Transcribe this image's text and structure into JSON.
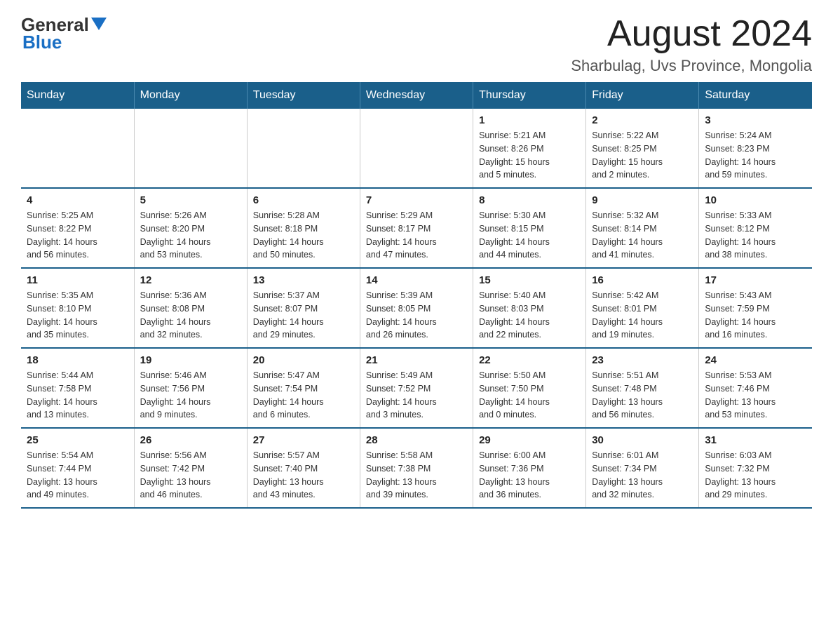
{
  "logo": {
    "general": "General",
    "blue": "Blue"
  },
  "header": {
    "title": "August 2024",
    "location": "Sharbulag, Uvs Province, Mongolia"
  },
  "weekdays": [
    "Sunday",
    "Monday",
    "Tuesday",
    "Wednesday",
    "Thursday",
    "Friday",
    "Saturday"
  ],
  "weeks": [
    [
      {
        "day": "",
        "info": ""
      },
      {
        "day": "",
        "info": ""
      },
      {
        "day": "",
        "info": ""
      },
      {
        "day": "",
        "info": ""
      },
      {
        "day": "1",
        "info": "Sunrise: 5:21 AM\nSunset: 8:26 PM\nDaylight: 15 hours\nand 5 minutes."
      },
      {
        "day": "2",
        "info": "Sunrise: 5:22 AM\nSunset: 8:25 PM\nDaylight: 15 hours\nand 2 minutes."
      },
      {
        "day": "3",
        "info": "Sunrise: 5:24 AM\nSunset: 8:23 PM\nDaylight: 14 hours\nand 59 minutes."
      }
    ],
    [
      {
        "day": "4",
        "info": "Sunrise: 5:25 AM\nSunset: 8:22 PM\nDaylight: 14 hours\nand 56 minutes."
      },
      {
        "day": "5",
        "info": "Sunrise: 5:26 AM\nSunset: 8:20 PM\nDaylight: 14 hours\nand 53 minutes."
      },
      {
        "day": "6",
        "info": "Sunrise: 5:28 AM\nSunset: 8:18 PM\nDaylight: 14 hours\nand 50 minutes."
      },
      {
        "day": "7",
        "info": "Sunrise: 5:29 AM\nSunset: 8:17 PM\nDaylight: 14 hours\nand 47 minutes."
      },
      {
        "day": "8",
        "info": "Sunrise: 5:30 AM\nSunset: 8:15 PM\nDaylight: 14 hours\nand 44 minutes."
      },
      {
        "day": "9",
        "info": "Sunrise: 5:32 AM\nSunset: 8:14 PM\nDaylight: 14 hours\nand 41 minutes."
      },
      {
        "day": "10",
        "info": "Sunrise: 5:33 AM\nSunset: 8:12 PM\nDaylight: 14 hours\nand 38 minutes."
      }
    ],
    [
      {
        "day": "11",
        "info": "Sunrise: 5:35 AM\nSunset: 8:10 PM\nDaylight: 14 hours\nand 35 minutes."
      },
      {
        "day": "12",
        "info": "Sunrise: 5:36 AM\nSunset: 8:08 PM\nDaylight: 14 hours\nand 32 minutes."
      },
      {
        "day": "13",
        "info": "Sunrise: 5:37 AM\nSunset: 8:07 PM\nDaylight: 14 hours\nand 29 minutes."
      },
      {
        "day": "14",
        "info": "Sunrise: 5:39 AM\nSunset: 8:05 PM\nDaylight: 14 hours\nand 26 minutes."
      },
      {
        "day": "15",
        "info": "Sunrise: 5:40 AM\nSunset: 8:03 PM\nDaylight: 14 hours\nand 22 minutes."
      },
      {
        "day": "16",
        "info": "Sunrise: 5:42 AM\nSunset: 8:01 PM\nDaylight: 14 hours\nand 19 minutes."
      },
      {
        "day": "17",
        "info": "Sunrise: 5:43 AM\nSunset: 7:59 PM\nDaylight: 14 hours\nand 16 minutes."
      }
    ],
    [
      {
        "day": "18",
        "info": "Sunrise: 5:44 AM\nSunset: 7:58 PM\nDaylight: 14 hours\nand 13 minutes."
      },
      {
        "day": "19",
        "info": "Sunrise: 5:46 AM\nSunset: 7:56 PM\nDaylight: 14 hours\nand 9 minutes."
      },
      {
        "day": "20",
        "info": "Sunrise: 5:47 AM\nSunset: 7:54 PM\nDaylight: 14 hours\nand 6 minutes."
      },
      {
        "day": "21",
        "info": "Sunrise: 5:49 AM\nSunset: 7:52 PM\nDaylight: 14 hours\nand 3 minutes."
      },
      {
        "day": "22",
        "info": "Sunrise: 5:50 AM\nSunset: 7:50 PM\nDaylight: 14 hours\nand 0 minutes."
      },
      {
        "day": "23",
        "info": "Sunrise: 5:51 AM\nSunset: 7:48 PM\nDaylight: 13 hours\nand 56 minutes."
      },
      {
        "day": "24",
        "info": "Sunrise: 5:53 AM\nSunset: 7:46 PM\nDaylight: 13 hours\nand 53 minutes."
      }
    ],
    [
      {
        "day": "25",
        "info": "Sunrise: 5:54 AM\nSunset: 7:44 PM\nDaylight: 13 hours\nand 49 minutes."
      },
      {
        "day": "26",
        "info": "Sunrise: 5:56 AM\nSunset: 7:42 PM\nDaylight: 13 hours\nand 46 minutes."
      },
      {
        "day": "27",
        "info": "Sunrise: 5:57 AM\nSunset: 7:40 PM\nDaylight: 13 hours\nand 43 minutes."
      },
      {
        "day": "28",
        "info": "Sunrise: 5:58 AM\nSunset: 7:38 PM\nDaylight: 13 hours\nand 39 minutes."
      },
      {
        "day": "29",
        "info": "Sunrise: 6:00 AM\nSunset: 7:36 PM\nDaylight: 13 hours\nand 36 minutes."
      },
      {
        "day": "30",
        "info": "Sunrise: 6:01 AM\nSunset: 7:34 PM\nDaylight: 13 hours\nand 32 minutes."
      },
      {
        "day": "31",
        "info": "Sunrise: 6:03 AM\nSunset: 7:32 PM\nDaylight: 13 hours\nand 29 minutes."
      }
    ]
  ]
}
